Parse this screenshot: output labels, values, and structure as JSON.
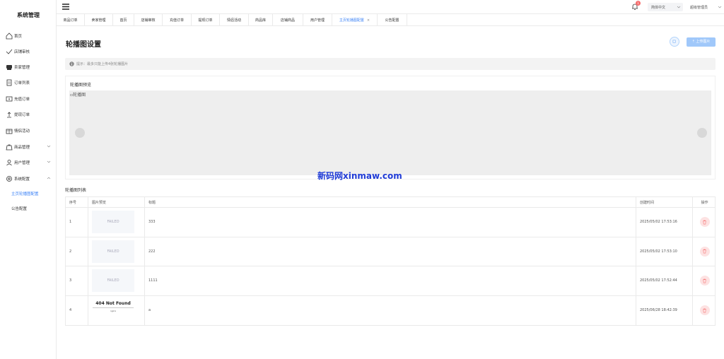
{
  "sidebar": {
    "title": "系统管理",
    "items": [
      {
        "label": "首页",
        "icon": "home-icon"
      },
      {
        "label": "店铺审核",
        "icon": "check-icon"
      },
      {
        "label": "卖家管理",
        "icon": "seller-icon"
      },
      {
        "label": "订单列表",
        "icon": "document-icon"
      },
      {
        "label": "充值订单",
        "icon": "recharge-icon"
      },
      {
        "label": "提现订单",
        "icon": "withdraw-icon"
      },
      {
        "label": "情侣活动",
        "icon": "gift-icon"
      },
      {
        "label": "商品管理",
        "icon": "bag-icon"
      },
      {
        "label": "用户管理",
        "icon": "user-icon"
      },
      {
        "label": "系统配置",
        "icon": "gear-icon"
      }
    ],
    "sub_items": [
      {
        "label": "主页轮播图配置",
        "active": true
      },
      {
        "label": "公告配置",
        "active": false
      }
    ]
  },
  "topbar": {
    "notification_count": "1",
    "language": "简体中文",
    "user": "超级管理员"
  },
  "tabs": [
    {
      "label": "商品订单"
    },
    {
      "label": "卖家管理"
    },
    {
      "label": "首页"
    },
    {
      "label": "店铺审核"
    },
    {
      "label": "充值订单"
    },
    {
      "label": "提现订单"
    },
    {
      "label": "情侣活动"
    },
    {
      "label": "商品库"
    },
    {
      "label": "店铺商品"
    },
    {
      "label": "用户管理"
    },
    {
      "label": "主页轮播图配置",
      "active": true,
      "close": "×"
    },
    {
      "label": "公告配置"
    }
  ],
  "page": {
    "title": "轮播图设置",
    "upload_button": "上传图片",
    "tip": "提示：最多只能上传4张轮播图片",
    "preview_title": "轮播图预览",
    "carousel_alt": "轮播图",
    "list_title": "轮播图列表"
  },
  "table": {
    "headers": [
      "序号",
      "图片预览",
      "标题",
      "创建时间",
      "操作"
    ],
    "rows": [
      {
        "index": "1",
        "image": "FAILED",
        "title": "333",
        "created": "2025/05/02 17:53:16"
      },
      {
        "index": "2",
        "image": "FAILED",
        "title": "222",
        "created": "2025/05/02 17:53:10"
      },
      {
        "index": "3",
        "image": "FAILED",
        "title": "1111",
        "created": "2025/05/02 17:52:44"
      },
      {
        "index": "4",
        "image_title": "404 Not Found",
        "image_sub": "nginx",
        "title": "a",
        "created": "2025/06/28 18:42:39"
      }
    ]
  },
  "watermark": "新码网xinmaw.com",
  "colors": {
    "accent": "#3b82f6",
    "danger": "#f56c6c",
    "upload_btn": "#a0c8fa"
  }
}
